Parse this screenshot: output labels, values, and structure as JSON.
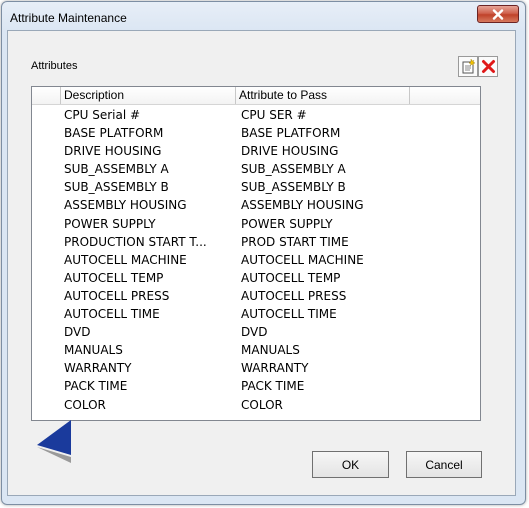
{
  "window": {
    "title": "Attribute Maintenance"
  },
  "group": {
    "label": "Attributes"
  },
  "toolbar": {
    "new_icon": "new-document-icon",
    "delete_icon": "delete-x-icon"
  },
  "columns": {
    "description": "Description",
    "attribute": "Attribute to Pass"
  },
  "rows": [
    {
      "description": "CPU Serial #",
      "attribute": "CPU SER #"
    },
    {
      "description": "BASE PLATFORM",
      "attribute": "BASE PLATFORM"
    },
    {
      "description": "DRIVE HOUSING",
      "attribute": "DRIVE HOUSING"
    },
    {
      "description": "SUB_ASSEMBLY A",
      "attribute": "SUB_ASSEMBLY A"
    },
    {
      "description": "SUB_ASSEMBLY B",
      "attribute": "SUB_ASSEMBLY B"
    },
    {
      "description": "ASSEMBLY HOUSING",
      "attribute": "ASSEMBLY HOUSING"
    },
    {
      "description": "POWER SUPPLY",
      "attribute": "POWER SUPPLY"
    },
    {
      "description": "PRODUCTION START T...",
      "attribute": "PROD START TIME"
    },
    {
      "description": "AUTOCELL MACHINE",
      "attribute": "AUTOCELL MACHINE"
    },
    {
      "description": "AUTOCELL TEMP",
      "attribute": "AUTOCELL TEMP"
    },
    {
      "description": "AUTOCELL PRESS",
      "attribute": "AUTOCELL PRESS"
    },
    {
      "description": "AUTOCELL TIME",
      "attribute": "AUTOCELL TIME"
    },
    {
      "description": "DVD",
      "attribute": "DVD"
    },
    {
      "description": "MANUALS",
      "attribute": "MANUALS"
    },
    {
      "description": "WARRANTY",
      "attribute": "WARRANTY"
    },
    {
      "description": "PACK TIME",
      "attribute": "PACK TIME"
    },
    {
      "description": "COLOR",
      "attribute": "COLOR"
    }
  ],
  "buttons": {
    "ok": "OK",
    "cancel": "Cancel"
  },
  "colors": {
    "title_bg": "#dbe6f3",
    "close_red": "#c0422a",
    "arrow_blue": "#1a3a9c"
  }
}
